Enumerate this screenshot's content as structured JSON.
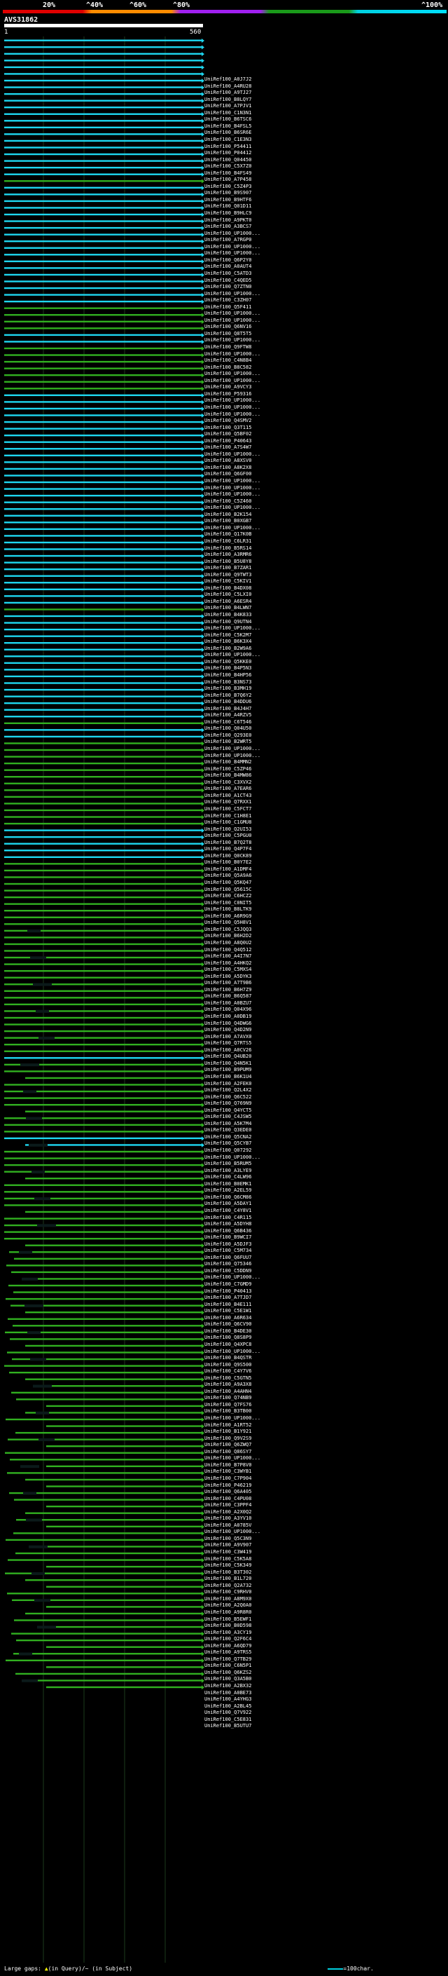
{
  "identity_scale": {
    "labels": [
      "20%",
      "^40%",
      "^60%",
      "^80%",
      "^100%"
    ],
    "colors": [
      "#e00000",
      "#ff8c00",
      "#a020f0",
      "#1a9a1a",
      "#00d0e0"
    ]
  },
  "query": {
    "name": "AVS31862",
    "start": "1",
    "end": "560"
  },
  "colors": {
    "cyan": "#1ed7f0",
    "green": "#31b020",
    "gap_dark": "#0b1a1a",
    "grid": "#1c3a1c"
  },
  "hits": [
    "UniRef100_A0J7J2",
    "UniRef100_A4RU28",
    "UniRef100_A9TJ27",
    "UniRef100_B8LQY7",
    "UniRef100_A7PJV1",
    "UniRef100_C1N3N1",
    "UniRef100_B6TSC6",
    "UniRef100_B4FSL5",
    "UniRef100_B6SR6E",
    "UniRef100_C1E3N3",
    "UniRef100_P54411",
    "UniRef100_P04412",
    "UniRef100_Q04450",
    "UniRef100_C5X7Z0",
    "UniRef100_B4FS49",
    "UniRef100_A7P458",
    "UniRef100_C5Z4P3",
    "UniRef100_B9S907",
    "UniRef100_B9HTF6",
    "UniRef100_Q01D11",
    "UniRef100_B9HLC9",
    "UniRef100_A9PKT0",
    "UniRef100_A3BCS7",
    "UniRef100_UP1000...",
    "UniRef100_A7RGP0",
    "UniRef100_UP1000...",
    "UniRef100_UP1000...",
    "UniRef100_Q6P2Y0",
    "UniRef100_A0AUT4",
    "UniRef100_C5ATD3",
    "UniRef100_C4QED5",
    "UniRef100_Q7ZTN0",
    "UniRef100_UP1000...",
    "UniRef100_C3ZH07",
    "UniRef100_Q5F411",
    "UniRef100_UP1000...",
    "UniRef100_UP1000...",
    "UniRef100_Q6NV16",
    "UniRef100_Q8T5T5",
    "UniRef100_UP1000...",
    "UniRef100_Q9FTW8",
    "UniRef100_UP1000...",
    "UniRef100_C4N8B4",
    "UniRef100_B8C582",
    "UniRef100_UP1000...",
    "UniRef100_UP1000...",
    "UniRef100_A9VCY3",
    "UniRef100_P59316",
    "UniRef100_UP1000...",
    "UniRef100_UP1000...",
    "UniRef100_UP1000...",
    "UniRef100_Q4SMV2",
    "UniRef100_Q3T115",
    "UniRef100_Q5BF02",
    "UniRef100_P40643",
    "UniRef100_A7S4W7",
    "UniRef100_UP1000...",
    "UniRef100_A8XSV0",
    "UniRef100_A8K2X8",
    "UniRef100_Q6GF00",
    "UniRef100_UP1000...",
    "UniRef100_UP1000...",
    "UniRef100_UP1000...",
    "UniRef100_C5Z460",
    "UniRef100_UP1000...",
    "UniRef100_B2K154",
    "UniRef100_B0XGB7",
    "UniRef100_UP1000...",
    "UniRef100_Q17K0B",
    "UniRef100_C6LR31",
    "UniRef100_B5RS14",
    "UniRef100_A3RMR6",
    "UniRef100_B5U8Y8",
    "UniRef100_B7ZAR1",
    "UniRef100_Q9TWT3",
    "UniRef100_C5KIV1",
    "UniRef100_B4DX08",
    "UniRef100_C5LXI0",
    "UniRef100_A6ESR4",
    "UniRef100_B4LWN7",
    "UniRef100_B4K833",
    "UniRef100_Q9UTN4",
    "UniRef100_UP1000...",
    "UniRef100_C5K2M7",
    "UniRef100_B6K3X4",
    "UniRef100_B2W9A6",
    "UniRef100_UP1000...",
    "UniRef100_Q5KKE0",
    "UniRef100_B4P5N3",
    "UniRef100_B4HP56",
    "UniRef100_B3NS73",
    "UniRef100_B3MH19",
    "UniRef100_B7Q6Y2",
    "UniRef100_B4DDU6",
    "UniRef100_B4J4H7",
    "UniRef100_A4RZV5",
    "UniRef100_C6T546",
    "UniRef100_Q04U50",
    "UniRef100_Q293E0",
    "UniRef100_B2WRT5",
    "UniRef100_UP1000...",
    "UniRef100_UP1000...",
    "UniRef100_B4MMN2",
    "UniRef100_C5ZP46",
    "UniRef100_B4MW86",
    "UniRef100_C3XVX2",
    "UniRef100_A7EAR6",
    "UniRef100_A1CT43",
    "UniRef100_Q7RXX1",
    "UniRef100_C5FCT7",
    "UniRef100_C1H8E1",
    "UniRef100_C1GMU8",
    "UniRef100_Q2UI53",
    "UniRef100_C5PGU0",
    "UniRef100_B7Q2T8",
    "UniRef100_Q4P7F4",
    "UniRef100_Q0CK89",
    "UniRef100_B0Y7E2",
    "UniRef100_A1DMF4",
    "UniRef100_Q5A9A6",
    "UniRef100_Q5KQ47",
    "UniRef100_Q5615C",
    "UniRef100_C6HCZ2",
    "UniRef100_C0NIT5",
    "UniRef100_B8LTK9",
    "UniRef100_A6R9G9",
    "UniRef100_Q5H8V1",
    "UniRef100_C5JQQ3",
    "UniRef100_B6H2D2",
    "UniRef100_A8Q0U2",
    "UniRef100_Q4Q512",
    "UniRef100_A4I7N7",
    "UniRef100_A4HKQ2",
    "UniRef100_C5MXS4",
    "UniRef100_A5DYK3",
    "UniRef100_A7T9B6",
    "UniRef100_B6H7Z9",
    "UniRef100_B6Q587",
    "UniRef100_A0BZU7",
    "UniRef100_Q04X96",
    "UniRef100_A0DB19",
    "UniRef100_Q4DWG6",
    "UniRef100_Q4D2N9",
    "UniRef100_A7AVX0",
    "UniRef100_Q7RTS5",
    "UniRef100_A0CV26",
    "UniRef100_Q4UB20",
    "UniRef100_Q4N5K1",
    "UniRef100_B9PUM9",
    "UniRef100_B6K1U4",
    "UniRef100_A2FEK0",
    "UniRef100_Q2L4X2",
    "UniRef100_Q6C522",
    "UniRef100_Q769N9",
    "UniRef100_Q4YCT5",
    "UniRef100_C4JSW5",
    "UniRef100_A5K7M4",
    "UniRef100_Q3EDE0",
    "UniRef100_Q5CNA2",
    "UniRef100_Q5CYB7",
    "UniRef100_Q07292",
    "UniRef100_UP1000...",
    "UniRef100_B5RUM5",
    "UniRef100_A3LYE9",
    "UniRef100_C4LW96",
    "UniRef100_B0EMK1",
    "UniRef100_A2EL59",
    "UniRef100_Q6CM86",
    "UniRef100_A5DAY1",
    "UniRef100_C4Y8V1",
    "UniRef100_C4R115",
    "UniRef100_A5DYH8",
    "UniRef100_Q6B436",
    "UniRef100_B9WCI7",
    "UniRef100_A5DJF3",
    "UniRef100_C5M734",
    "UniRef100_Q6FUU7",
    "UniRef100_Q75346",
    "UniRef100_C5DDN9",
    "UniRef100_UP1000...",
    "UniRef100_C7GMD9",
    "UniRef100_P40413",
    "UniRef100_A7TJD7",
    "UniRef100_B4E111",
    "UniRef100_C5E1W1",
    "UniRef100_A6R634",
    "UniRef100_Q6CV90",
    "UniRef100_B4DE30",
    "UniRef100_Q8S8P9",
    "UniRef100_Q4XPC8",
    "UniRef100_UP1000...",
    "UniRef100_B4QSTR",
    "UniRef100_Q9S500",
    "UniRef100_C4Y7V6",
    "UniRef100_C5GTN5",
    "UniRef100_A9A3X8",
    "UniRef100_A4AHN4",
    "UniRef100_Q74NB9",
    "UniRef100_Q7FS76",
    "UniRef100_B3TB00",
    "UniRef100_UP1000...",
    "UniRef100_A1RT52",
    "UniRef100_B1Y921",
    "UniRef100_Q9V2S9",
    "UniRef100_Q6ZWQ7",
    "UniRef100_Q86SY7",
    "UniRef100_UP1000...",
    "UniRef100_B7P8V0",
    "UniRef100_C3WYB1",
    "UniRef100_C7P904",
    "UniRef100_P46219",
    "UniRef100_Q6A405",
    "UniRef100_C4PU08",
    "UniRef100_C3PPF4",
    "UniRef100_A2X0Q2",
    "UniRef100_A3YV10",
    "UniRef100_A0785V",
    "UniRef100_UP1000...",
    "UniRef100_Q5C3N9",
    "UniRef100_A9V907",
    "UniRef100_C3W419",
    "UniRef100_C5K5A8",
    "UniRef100_C5K349",
    "UniRef100_B3T302",
    "UniRef100_B1L720",
    "UniRef100_Q2A732",
    "UniRef100_C9RHV0",
    "UniRef100_A8M9X0",
    "UniRef100_A2Q0A0",
    "UniRef100_A9R8R0",
    "UniRef100_B5EWF1",
    "UniRef100_B0D598",
    "UniRef100_A3CY19",
    "UniRef100_Q2F6C4",
    "UniRef100_A6QD79",
    "UniRef100_A9TRS5",
    "UniRef100_Q7TB29",
    "UniRef100_C6N5P1",
    "UniRef100_Q6KZS2",
    "UniRef100_Q3A5B0",
    "UniRef100_A2BX32",
    "UniRef100_A0BE73",
    "UniRef100_A4YHG3",
    "UniRef100_A2BL45",
    "UniRef100_Q7V922",
    "UniRef100_C5E831",
    "UniRef100_B5UTU7"
  ],
  "footer": {
    "large_gaps_label": "Large gaps:",
    "query_gap_label": "(in Query)",
    "subject_gap_label": "/~ (in Subject)",
    "legend_label": "=100char."
  }
}
